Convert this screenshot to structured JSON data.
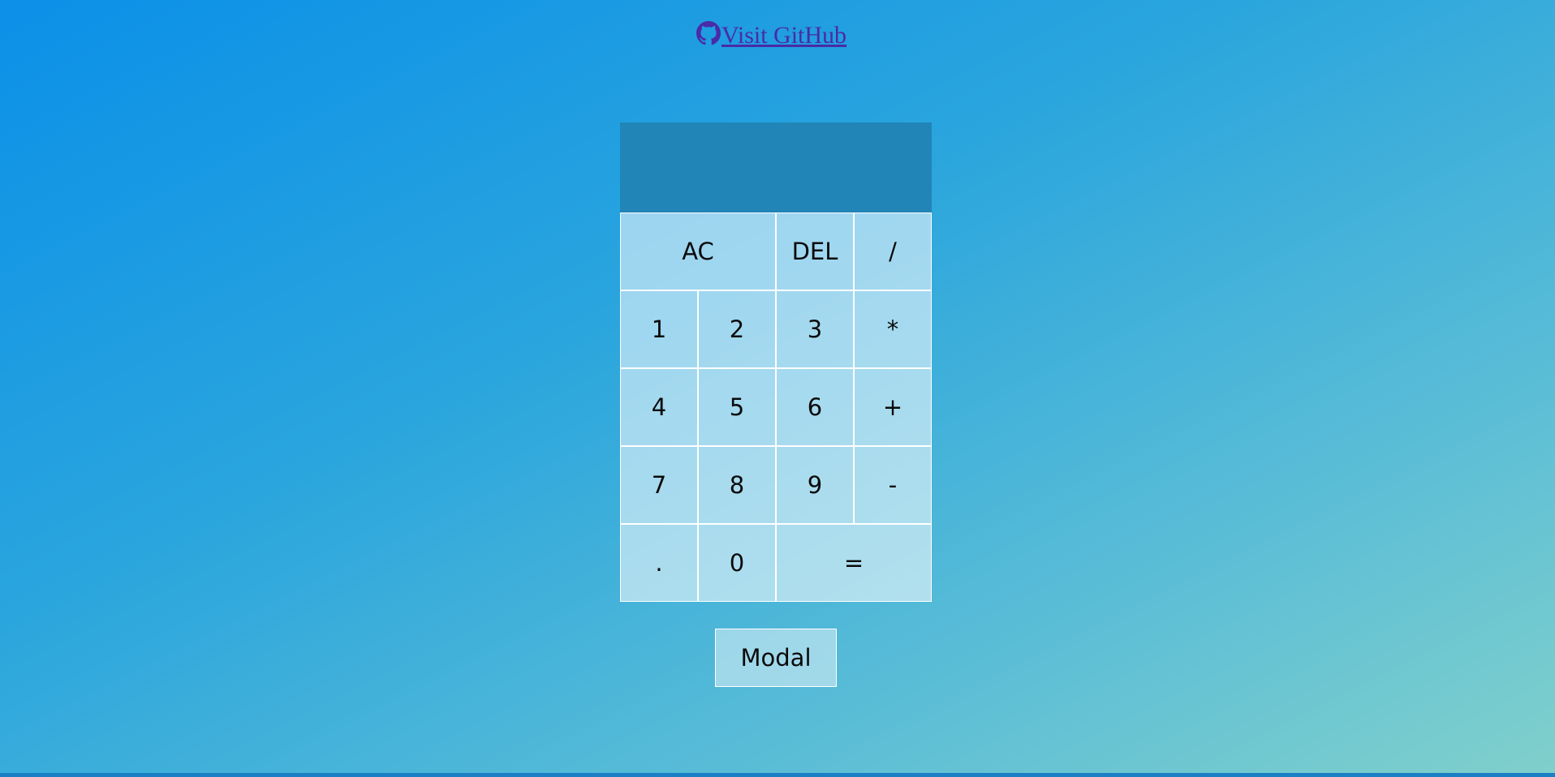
{
  "header": {
    "link_label": "Visit GitHub",
    "icon": "github-icon"
  },
  "calculator": {
    "display_value": "",
    "keys": [
      {
        "label": "AC",
        "name": "ac-key",
        "span": 2
      },
      {
        "label": "DEL",
        "name": "delete-key",
        "span": 1
      },
      {
        "label": "/",
        "name": "divide-key",
        "span": 1
      },
      {
        "label": "1",
        "name": "digit-1-key",
        "span": 1
      },
      {
        "label": "2",
        "name": "digit-2-key",
        "span": 1
      },
      {
        "label": "3",
        "name": "digit-3-key",
        "span": 1
      },
      {
        "label": "*",
        "name": "multiply-key",
        "span": 1
      },
      {
        "label": "4",
        "name": "digit-4-key",
        "span": 1
      },
      {
        "label": "5",
        "name": "digit-5-key",
        "span": 1
      },
      {
        "label": "6",
        "name": "digit-6-key",
        "span": 1
      },
      {
        "label": "+",
        "name": "add-key",
        "span": 1
      },
      {
        "label": "7",
        "name": "digit-7-key",
        "span": 1
      },
      {
        "label": "8",
        "name": "digit-8-key",
        "span": 1
      },
      {
        "label": "9",
        "name": "digit-9-key",
        "span": 1
      },
      {
        "label": "-",
        "name": "subtract-key",
        "span": 1
      },
      {
        "label": ".",
        "name": "decimal-key",
        "span": 1
      },
      {
        "label": "0",
        "name": "digit-0-key",
        "span": 1
      },
      {
        "label": "=",
        "name": "equals-key",
        "span": 2
      }
    ]
  },
  "modal": {
    "button_label": "Modal"
  },
  "colors": {
    "link": "#4a2aa8",
    "display_bg": "#2185b7",
    "key_border": "#ffffff"
  }
}
